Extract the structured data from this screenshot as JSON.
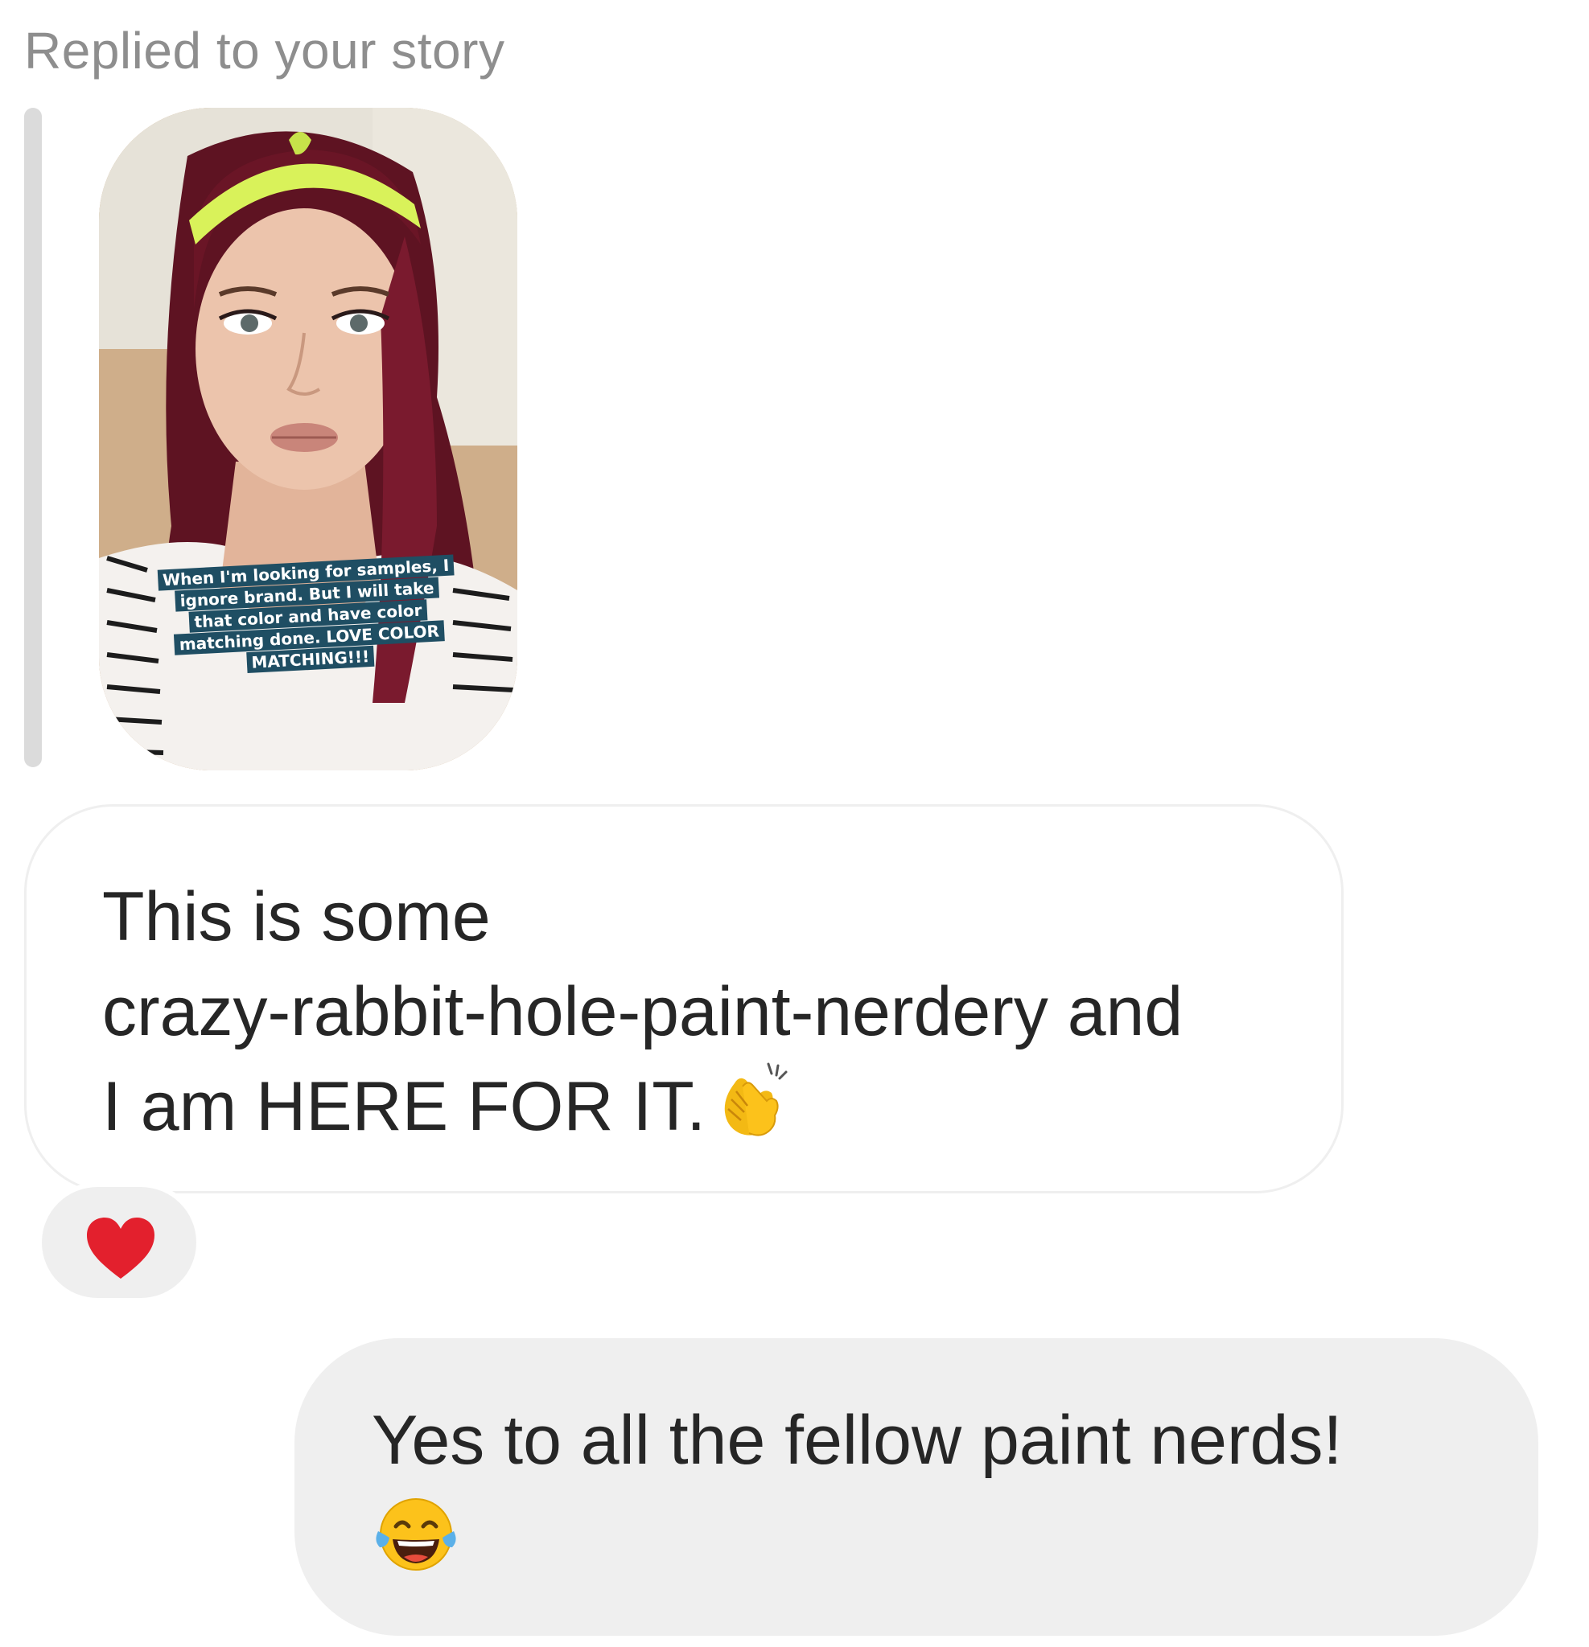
{
  "header": {
    "reply_label": "Replied to your story"
  },
  "story": {
    "caption_lines": [
      "When I'm looking for samples, I",
      "ignore brand. But I will take",
      "that color and have color",
      "matching done. LOVE COLOR",
      "MATCHING!!!"
    ]
  },
  "messages": [
    {
      "direction": "received",
      "lines": [
        "This is some",
        "crazy-rabbit-hole-paint-nerdery and",
        "I am HERE FOR IT."
      ],
      "emoji": "clapping-hands-icon",
      "reaction": "red-heart-icon"
    },
    {
      "direction": "sent",
      "text": "Yes to all the fellow paint nerds!",
      "emoji": "tears-of-joy-icon"
    }
  ],
  "colors": {
    "label_gray": "#8e8e8e",
    "bubble_border": "#efefef",
    "sent_bubble_bg": "#efefef",
    "text": "#262626",
    "heart_red": "#e3202d",
    "caption_bg": "#1f4e63",
    "headband_yellow": "#d9f25a"
  }
}
